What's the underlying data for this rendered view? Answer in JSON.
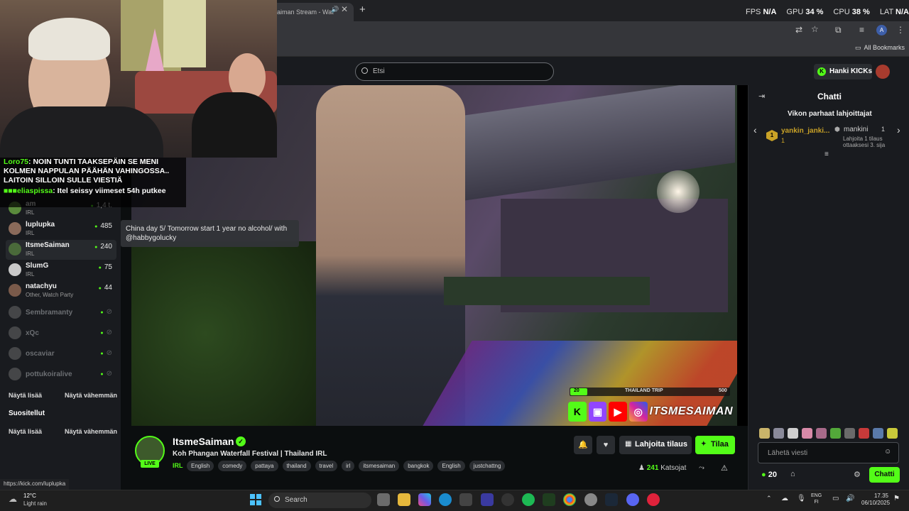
{
  "browser": {
    "tab_title": "aiman Stream - Wat",
    "perf": {
      "fps_label": "FPS",
      "fps_value": "N/A",
      "gpu_label": "GPU",
      "gpu_value": "34",
      "cpu_label": "CPU",
      "cpu_value": "38",
      "lat_label": "LAT",
      "lat_value": "N/A",
      "percent": "%"
    },
    "bookmarks_label": "All Bookmarks",
    "profile_initial": "A"
  },
  "header": {
    "search_placeholder": "Etsi",
    "kicks_button": "Hanki KICKs"
  },
  "overlay": {
    "messages": [
      {
        "user": "Loro75",
        "text": "NOIN TUNTI TAAKSEPÄIN SE MENI KOLMEN NAPPULAN PÄÄHÄN VAHINGOSSA.. LAITOIN SILLOIN SULLE VIESTIÄ"
      },
      {
        "user": "eliaspissa",
        "text": "Itel seissy viimeset 54h putkee"
      }
    ]
  },
  "sidebar": {
    "channels": [
      {
        "name": "am",
        "category": "IRL",
        "viewers": "1,4 t.",
        "live": true,
        "color": "#5a8a3c"
      },
      {
        "name": "luplupka",
        "category": "IRL",
        "viewers": "485",
        "live": true,
        "color": "#8a6a5a"
      },
      {
        "name": "ItsmeSaiman",
        "category": "IRL",
        "viewers": "240",
        "live": true,
        "color": "#4a6a3a"
      },
      {
        "name": "SlumG",
        "category": "IRL",
        "viewers": "75",
        "live": true,
        "color": "#c9c9c9"
      },
      {
        "name": "natachyu",
        "category": "Other, Watch Party",
        "viewers": "44",
        "live": true,
        "color": "#7a5a4a"
      },
      {
        "name": "Sembramanty",
        "live": false,
        "color": "#888"
      },
      {
        "name": "xQc",
        "live": false,
        "color": "#888"
      },
      {
        "name": "oscaviar",
        "live": false,
        "color": "#888"
      },
      {
        "name": "pottukoiralive",
        "live": false,
        "color": "#888"
      }
    ],
    "show_more": "Näytä lisää",
    "show_less": "Näytä vähemmän",
    "recommended_title": "Suositellut",
    "show_more_2": "Näytä lisää",
    "show_less_2": "Näytä vähemmän"
  },
  "video": {
    "tooltip": "China day 5/ Tomorrow start 1 year no alcohol/ with @habbygolucky",
    "overlay_brand": "ITSMESAIMAN",
    "goal_label": "THAILAND TRIP",
    "goal_current": "20",
    "goal_max": "500",
    "goal_fraction": 0.04
  },
  "stream": {
    "live_badge": "LIVE",
    "streamer": "ItsmeSaiman",
    "title": "Koh Phangan Waterfall Festival | Thailand IRL",
    "category": "IRL",
    "tags": [
      "English",
      "comedy",
      "pattaya",
      "thailand",
      "travel",
      "irl",
      "itsmesaiman",
      "bangkok",
      "English",
      "justchattng"
    ],
    "gift_button": "Lahjoita tilaus",
    "follow_button": "Tilaa",
    "viewers_count": "241",
    "viewers_label": "Katsojat"
  },
  "chat": {
    "title": "Chatti",
    "leaderboard_title": "Vikon parhaat lahjoittajat",
    "leader1": {
      "rank": "1",
      "name": "yankin_janki...",
      "value": "1"
    },
    "leader2": {
      "name": "mankini",
      "value": "1",
      "note": "Lahjoita 1 tilaus ottaaksesi 3. sija"
    },
    "input_placeholder": "Lähetä viesti",
    "kicks_count": "20",
    "chat_button": "Chatti"
  },
  "status_url": "https://kick.com/luplupka",
  "taskbar": {
    "temperature": "12°C",
    "weather": "Light rain",
    "search_placeholder": "Search",
    "lang_top": "ENG",
    "lang_bottom": "FI",
    "time": "17.35",
    "date": "06/10/2025"
  }
}
